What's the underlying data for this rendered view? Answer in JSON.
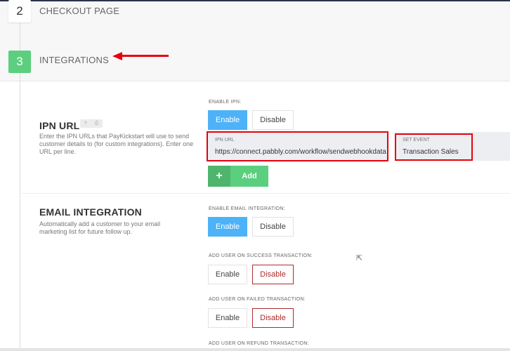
{
  "steps": [
    {
      "number": "2",
      "label": "CHECKOUT PAGE"
    },
    {
      "number": "3",
      "label": "INTEGRATIONS"
    }
  ],
  "ipn": {
    "title": "IPN URL",
    "help_icons": [
      "?",
      "⎙"
    ],
    "description": "Enter the IPN URLs that PayKickstart will use to send customer details to (for custom integrations). Enter one URL per line.",
    "enable_label": "ENABLE IPN:",
    "enable": "Enable",
    "disable": "Disable",
    "url_label": "IPN URL",
    "url_value": "https://connect.pabbly.com/workflow/sendwebhookdata",
    "event_label": "SET EVENT",
    "event_value": "Transaction Sales",
    "add": "Add",
    "add_icon": "+"
  },
  "email": {
    "title": "EMAIL INTEGRATION",
    "description": "Automatically add a customer to your email marketing list for future follow up.",
    "enable_label": "ENABLE EMAIL INTEGRATION:",
    "success_label": "ADD USER ON SUCCESS TRANSACTION:",
    "failed_label": "ADD USER ON FAILED TRANSACTION:",
    "refund_label": "ADD USER ON REFUND TRANSACTION:",
    "enable": "Enable",
    "disable": "Disable"
  },
  "colors": {
    "accent_blue": "#4db2f7",
    "green": "#5ccf7f",
    "annotation_red": "#e8000b",
    "disable_red": "#b02a2a"
  }
}
